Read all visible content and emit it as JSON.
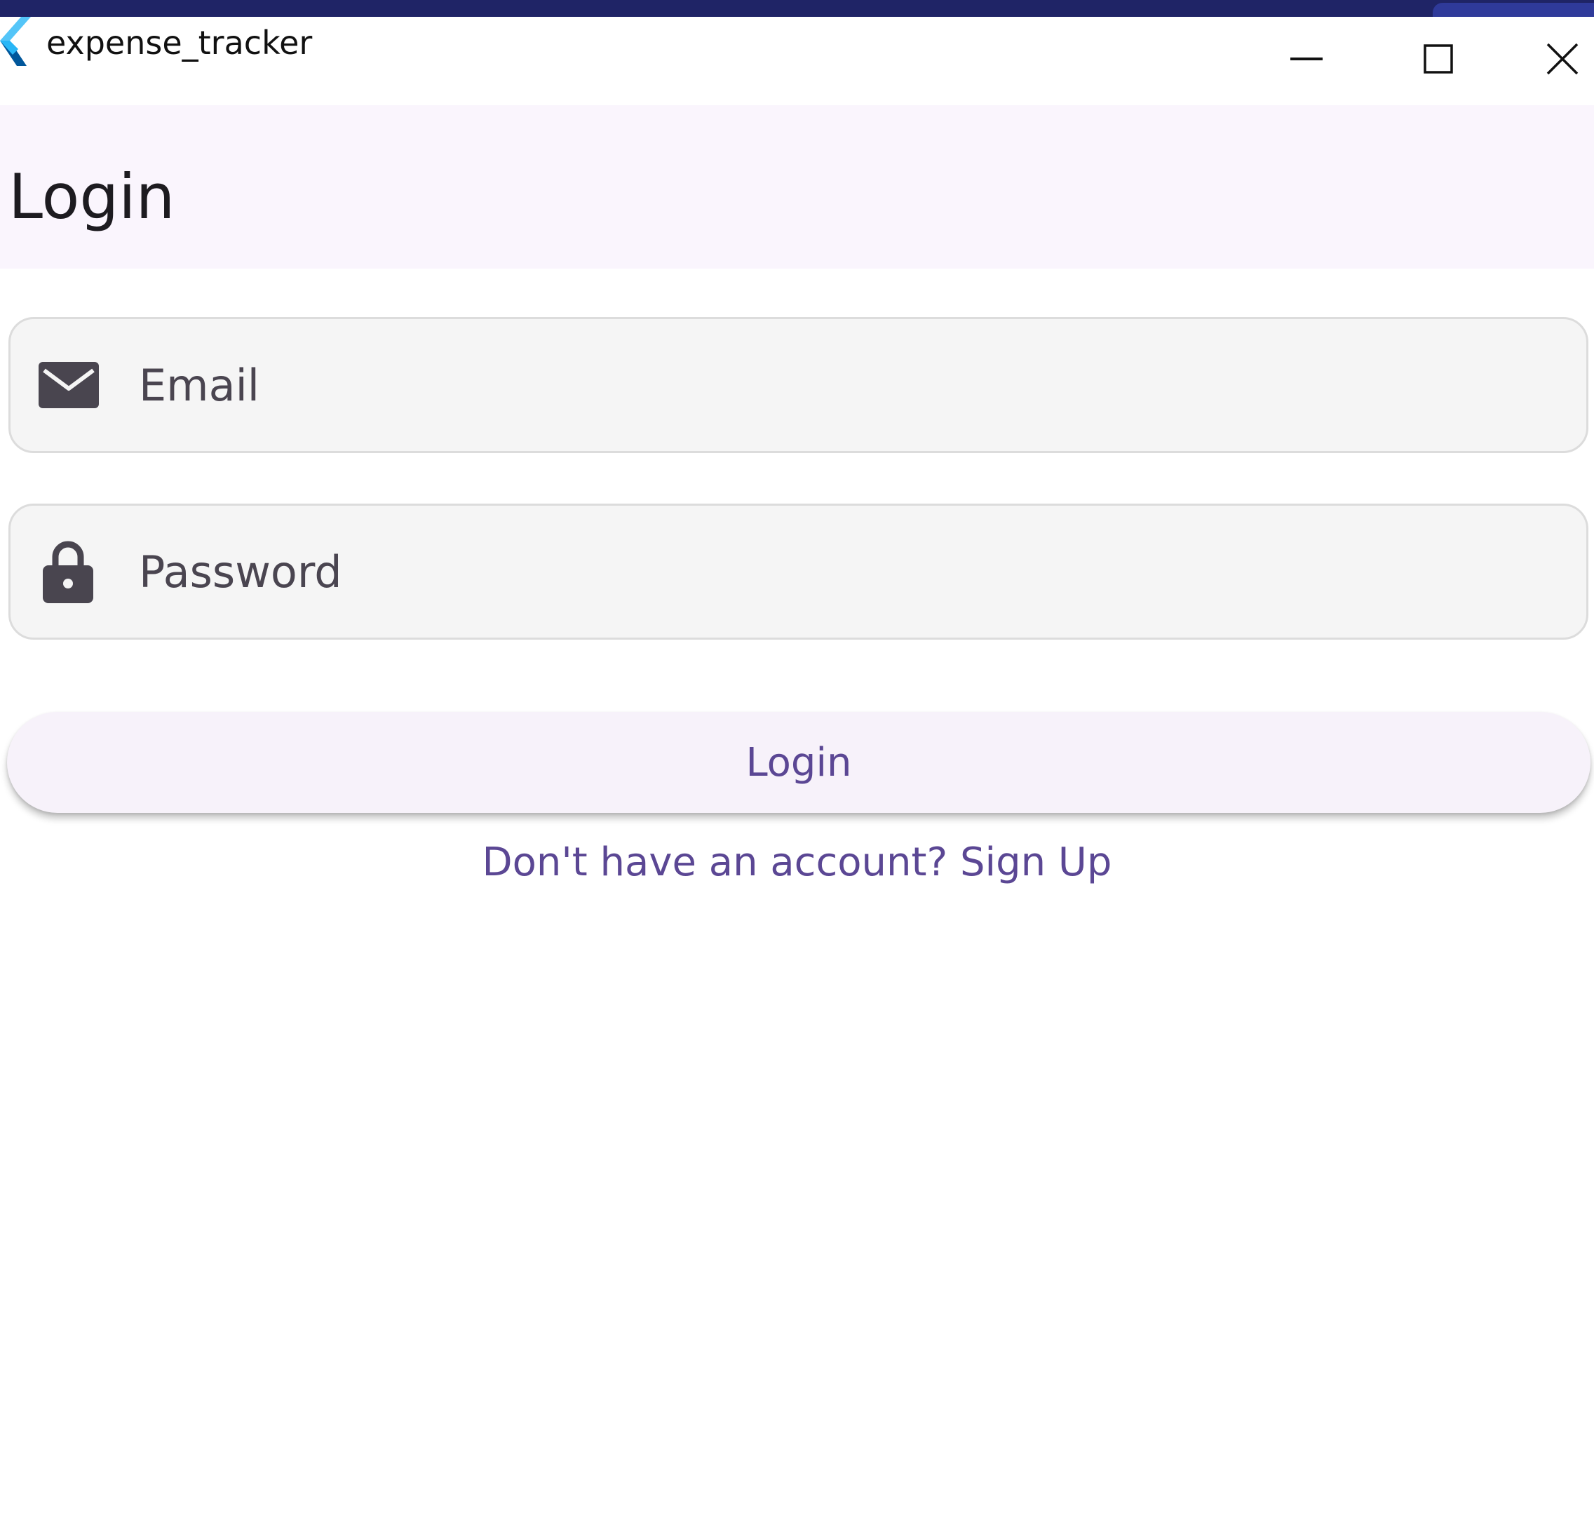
{
  "window": {
    "title": "expense_tracker",
    "controls": {
      "minimize": "minimize-icon",
      "maximize": "maximize-icon",
      "close": "close-icon"
    }
  },
  "appbar": {
    "title": "Login"
  },
  "form": {
    "email": {
      "icon": "mail-icon",
      "placeholder": "Email",
      "value": ""
    },
    "password": {
      "icon": "lock-icon",
      "placeholder": "Password",
      "value": ""
    },
    "submit_label": "Login",
    "signup_link": "Don't have an account? Sign Up"
  },
  "colors": {
    "appbar_bg": "#faf5fd",
    "field_bg": "#f5f5f5",
    "button_bg": "#f7f2fa",
    "accent_text": "#5b4794",
    "icon_dark": "#49454f"
  }
}
